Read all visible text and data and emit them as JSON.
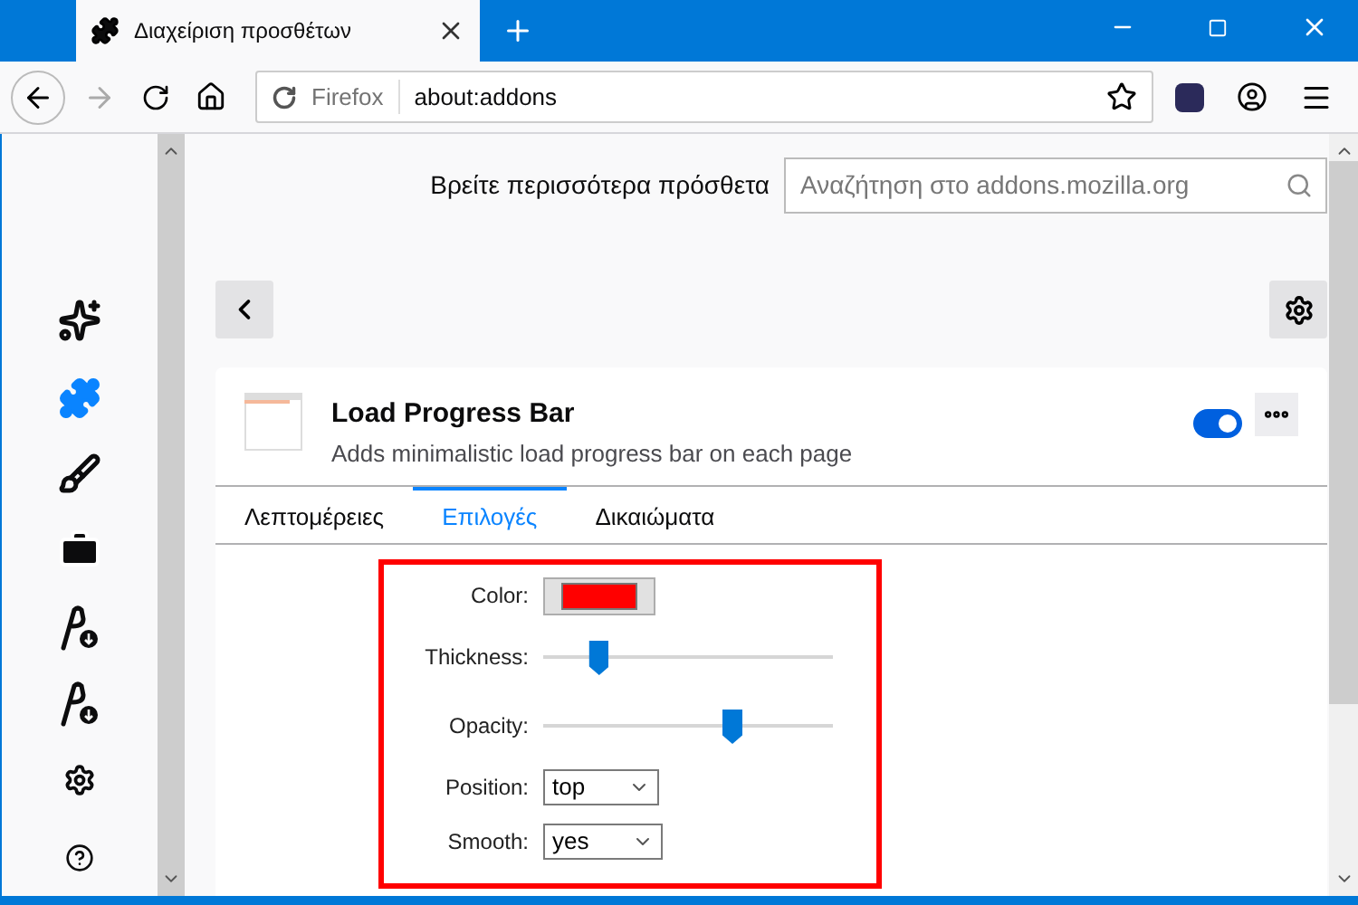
{
  "window": {
    "tab_title": "Διαχείριση προσθέτων"
  },
  "toolbar": {
    "identity": "Firefox",
    "url": "about:addons"
  },
  "sidebar": {
    "items": [
      {
        "kind": "recommendations",
        "selected": false
      },
      {
        "kind": "extensions",
        "selected": true
      },
      {
        "kind": "themes",
        "selected": false
      },
      {
        "kind": "plugins",
        "selected": false
      },
      {
        "kind": "languages",
        "selected": false
      },
      {
        "kind": "dictionaries",
        "selected": false
      },
      {
        "kind": "settings",
        "selected": false
      },
      {
        "kind": "help",
        "selected": false
      }
    ]
  },
  "search": {
    "label": "Βρείτε περισσότερα πρόσθετα",
    "placeholder": "Αναζήτηση στο addons.mozilla.org"
  },
  "addon": {
    "name": "Load Progress Bar",
    "description": "Adds minimalistic load progress bar on each page",
    "enabled": true
  },
  "tabs": [
    {
      "label": "Λεπτομέρειες",
      "selected": false
    },
    {
      "label": "Επιλογές",
      "selected": true
    },
    {
      "label": "Δικαιώματα",
      "selected": false
    }
  ],
  "options": [
    {
      "kind": "color",
      "label": "Color:",
      "color": "#ff0000"
    },
    {
      "kind": "slider",
      "label": "Thickness:",
      "level": 0.19
    },
    {
      "kind": "slider",
      "label": "Opacity:",
      "level": 0.65
    },
    {
      "kind": "select",
      "label": "Position:",
      "value": "top"
    },
    {
      "kind": "select",
      "label": "Smooth:",
      "value": "yes"
    }
  ]
}
